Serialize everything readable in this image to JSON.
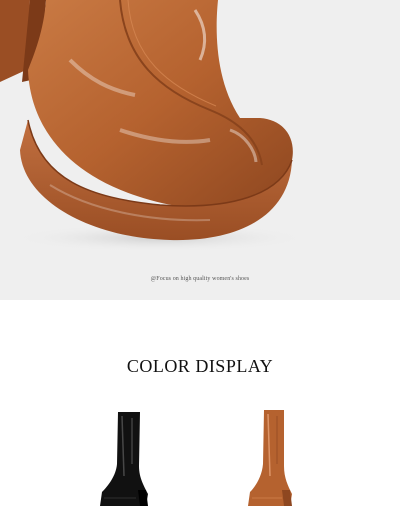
{
  "hero": {
    "image_name": "brown-patent-platform-boot-closeup",
    "caption": "@Focus on high quality women's shoes"
  },
  "color_display": {
    "title": "COLOR DISPLAY",
    "swatches": [
      {
        "name": "black-patent-boot",
        "color": "#111111"
      },
      {
        "name": "brown-patent-boot",
        "color": "#b5622f"
      }
    ]
  },
  "colors": {
    "background": "#ffffff",
    "hero_background": "#efefef",
    "boot_brown": "#b5622f",
    "boot_black": "#111111"
  }
}
